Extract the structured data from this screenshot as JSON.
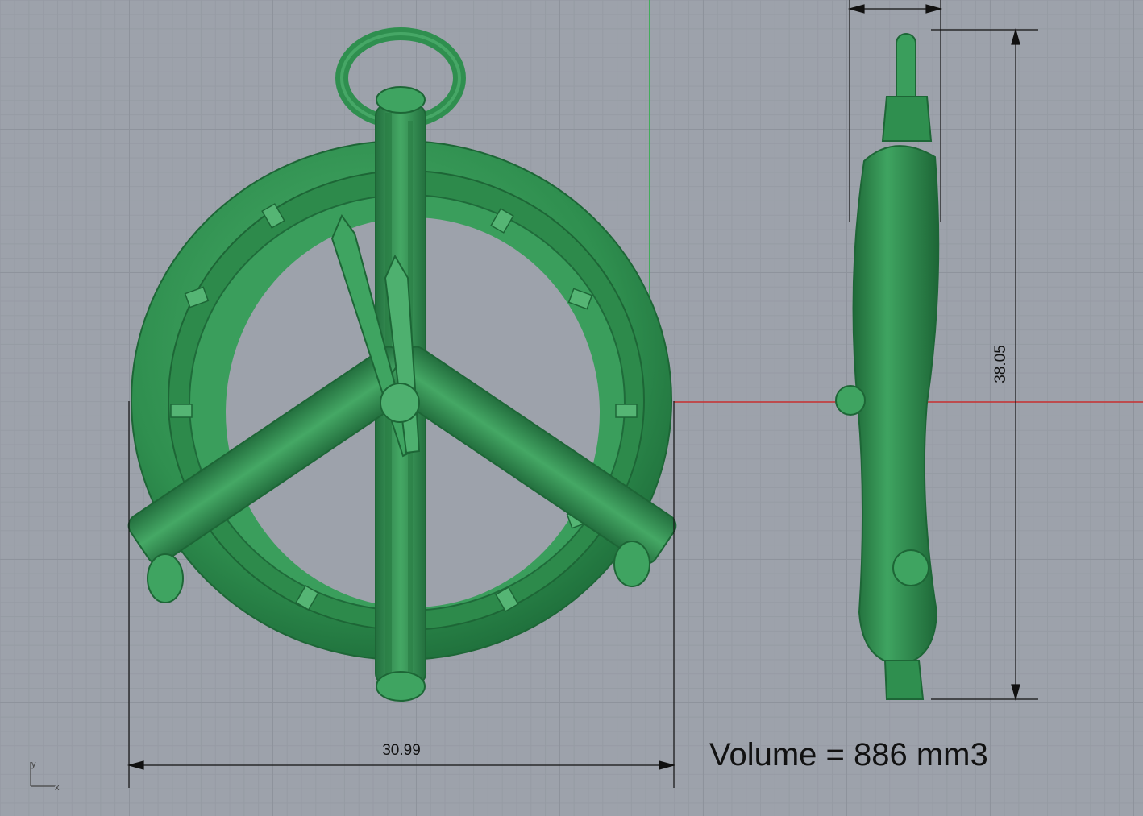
{
  "viewport": {
    "background": "#9da2ab",
    "axis_x_color": "#c83030",
    "axis_y_color": "#27b043",
    "model_color": "#2f8f4f"
  },
  "dimensions": {
    "width_value": "30.99",
    "height_value": "38.05"
  },
  "volume_label": "Volume = 886 mm3",
  "axis_icon": {
    "x_label": "x",
    "y_label": "y"
  }
}
